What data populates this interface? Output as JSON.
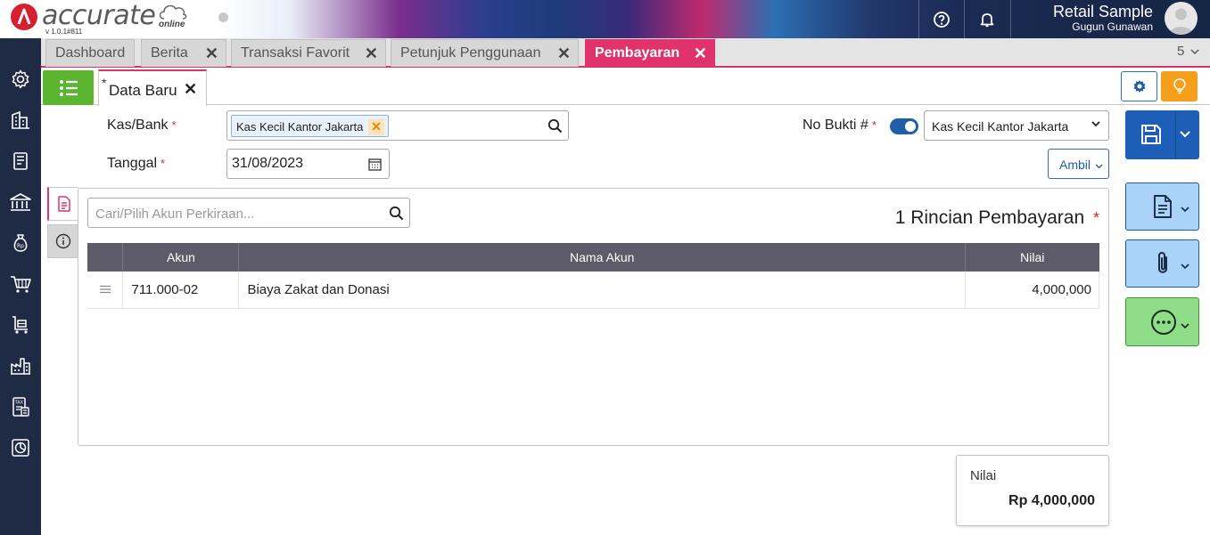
{
  "brand": {
    "name": "accurate",
    "sub": "online",
    "version": "v 1.0.1#811"
  },
  "header": {
    "company": "Retail Sample",
    "user": "Gugun Gunawan",
    "icons": [
      "help-icon",
      "bell-icon",
      "avatar"
    ]
  },
  "sidebar": {
    "items": [
      "settings-icon",
      "company-icon",
      "ledger-icon",
      "bank-icon",
      "money-bag-icon",
      "cart-icon",
      "inventory-cart-icon",
      "factory-icon",
      "tax-icon",
      "report-icon"
    ]
  },
  "tabs": [
    {
      "label": "Dashboard",
      "closable": false
    },
    {
      "label": "Berita",
      "closable": true
    },
    {
      "label": "Transaksi Favorit",
      "closable": true
    },
    {
      "label": "Petunjuk Penggunaan",
      "closable": true
    },
    {
      "label": "Pembayaran",
      "closable": true,
      "active": true
    }
  ],
  "tab_count": "5",
  "subtab": {
    "marker": "*",
    "label": "Data Baru"
  },
  "form": {
    "kas_bank_label": "Kas/Bank",
    "kas_bank_value": "Kas Kecil Kantor Jakarta",
    "tanggal_label": "Tanggal",
    "tanggal_value": "31/08/2023",
    "no_bukti_label": "No Bukti #",
    "no_bukti_select": "Kas Kecil Kantor Jakarta",
    "ambil_label": "Ambil",
    "required_mark": "*"
  },
  "detail": {
    "search_placeholder": "Cari/Pilih Akun Perkiraan...",
    "title": "1 Rincian Pembayaran",
    "columns": [
      "",
      "Akun",
      "Nama Akun",
      "Nilai"
    ],
    "rows": [
      {
        "akun": "711.000-02",
        "nama": "Biaya Zakat dan Donasi",
        "nilai": "4,000,000"
      }
    ]
  },
  "total": {
    "label": "Nilai",
    "value": "Rp 4,000,000"
  },
  "colors": {
    "accent": "#e0336b",
    "sidebar": "#1f2a44",
    "primary": "#1d5fb6",
    "list_button": "#5cb531",
    "bulb_button": "#f5a01a",
    "table_header": "#5d5b6a"
  }
}
